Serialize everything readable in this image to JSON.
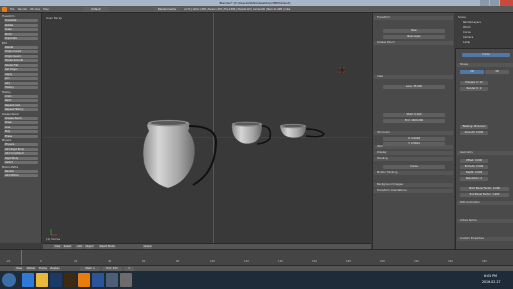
{
  "window": {
    "title": "Blender* [C:\\Users\\CRAIG\\Desktop\\VBE0\\blend]"
  },
  "menubar": {
    "items": [
      "File",
      "Render",
      "Window",
      "Help"
    ],
    "layout": "Default",
    "engine": "Blender Game",
    "stats": "v2.74 | Verts:1,350 | Faces:1,343 | Tris:2,686 | Objects:0/3 | Lamps:0/0 | Mem:11.92M | Cube"
  },
  "toolpanel": {
    "buttons": [
      "Translate",
      "Rotate",
      "Scale",
      "Mirror",
      "Duplicate",
      "Delete",
      "Origin Cursor",
      "Origin Geom",
      "Shade Smooth",
      "Shade Flat",
      "Set Origin",
      "Apply",
      "Join",
      "Add",
      "History",
      "Undo",
      "Redo",
      "Repeat Last",
      "Repeat History",
      "Grease Pencil",
      "Draw",
      "Line",
      "Poly",
      "Erase",
      "Physics",
      "Add Rigid Body",
      "Add Constraint",
      "Rigid Body",
      "Select",
      "Render",
      "Add Motion"
    ],
    "headers": [
      "Transform",
      "Edit",
      "History",
      "Grease Pencil",
      "Physics",
      "Motion Paths"
    ]
  },
  "viewport": {
    "view_label": "User Persp",
    "object_label": "(1) Curve",
    "header": [
      "View",
      "Select",
      "Add",
      "Object",
      "Object Mode",
      "Global"
    ]
  },
  "properties": {
    "sections": [
      "Transform",
      "Grease Pencil",
      "View",
      "3D Cursor",
      "Item",
      "Display",
      "Shading",
      "Motion Tracking",
      "Background Images",
      "Transform Orientations"
    ],
    "fields": {
      "lens": "Lens: 35.000",
      "clip_start": "Start: 0.100",
      "clip_end": "End: 1000.000",
      "x": "X: 0.0026",
      "y": "Y: 0.5814",
      "z": "Z: 0.000",
      "curve": "Curve",
      "new_layer": "New Layer",
      "new": "New"
    }
  },
  "outliner": {
    "items": [
      "Scene",
      "RenderLayers",
      "World",
      "Curve",
      "Camera",
      "Lamp"
    ]
  },
  "data_panel": {
    "object": "Curve",
    "shape": "Shape",
    "shape_options": [
      "2D",
      "3D"
    ],
    "fields": [
      "Preview U: 12",
      "Render U: 0",
      "Twisting: Minimum",
      "Smooth: 0.000",
      "Offset: 0.000",
      "Extrude: 0.000",
      "Depth: 0.000",
      "Resolution: 0",
      "Start Bevel Factor: 0.000",
      "End Bevel Factor: 1.000"
    ],
    "sections": [
      "Shape",
      "Geometry",
      "Path Animation",
      "Active Spline",
      "Custom Properties"
    ]
  },
  "timeline": {
    "controls": [
      "View",
      "Marker",
      "Frame",
      "Playback"
    ],
    "start": "Start: 1",
    "end": "End: 250",
    "current": "1",
    "ticks": [
      "-20",
      "0",
      "20",
      "40",
      "60",
      "80",
      "100",
      "120",
      "140",
      "160",
      "180",
      "200",
      "220",
      "240",
      "260"
    ]
  },
  "taskbar": {
    "time": "6:05 PM",
    "date": "2016-02-27",
    "colors": {
      "ie": "#2f7ad6",
      "explorer": "#e8b93a",
      "photoshop": "#1b3a66",
      "illustrator": "#3d2a10",
      "blender": "#e87d0d",
      "word": "#2a5699",
      "app7": "#4c5f76",
      "app8": "#6c6c6c"
    }
  }
}
